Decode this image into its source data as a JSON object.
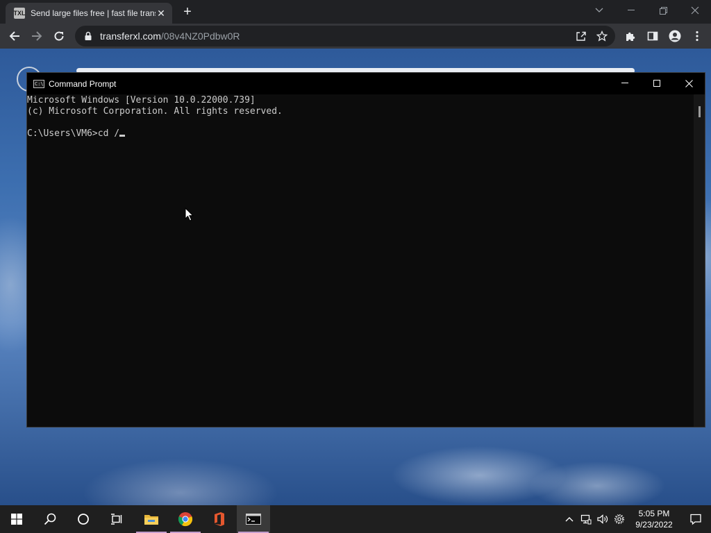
{
  "browser": {
    "tab": {
      "favicon_text": "TXL",
      "title": "Send large files free | fast file transfer"
    },
    "address": {
      "host": "transferxl.com",
      "path": "/08v4NZ0Pdbw0R"
    }
  },
  "cmd_window": {
    "title": "Command Prompt",
    "lines": [
      "Microsoft Windows [Version 10.0.22000.739]",
      "(c) Microsoft Corporation. All rights reserved.",
      "",
      "C:\\Users\\VM6>cd /"
    ]
  },
  "taskbar": {
    "clock": {
      "time": "5:05 PM",
      "date": "9/23/2022"
    }
  },
  "colors": {
    "terminal_bg": "#0c0c0c",
    "terminal_text": "#cccccc",
    "taskbar_bg": "#1f1f1f",
    "browser_frame": "#202124"
  }
}
